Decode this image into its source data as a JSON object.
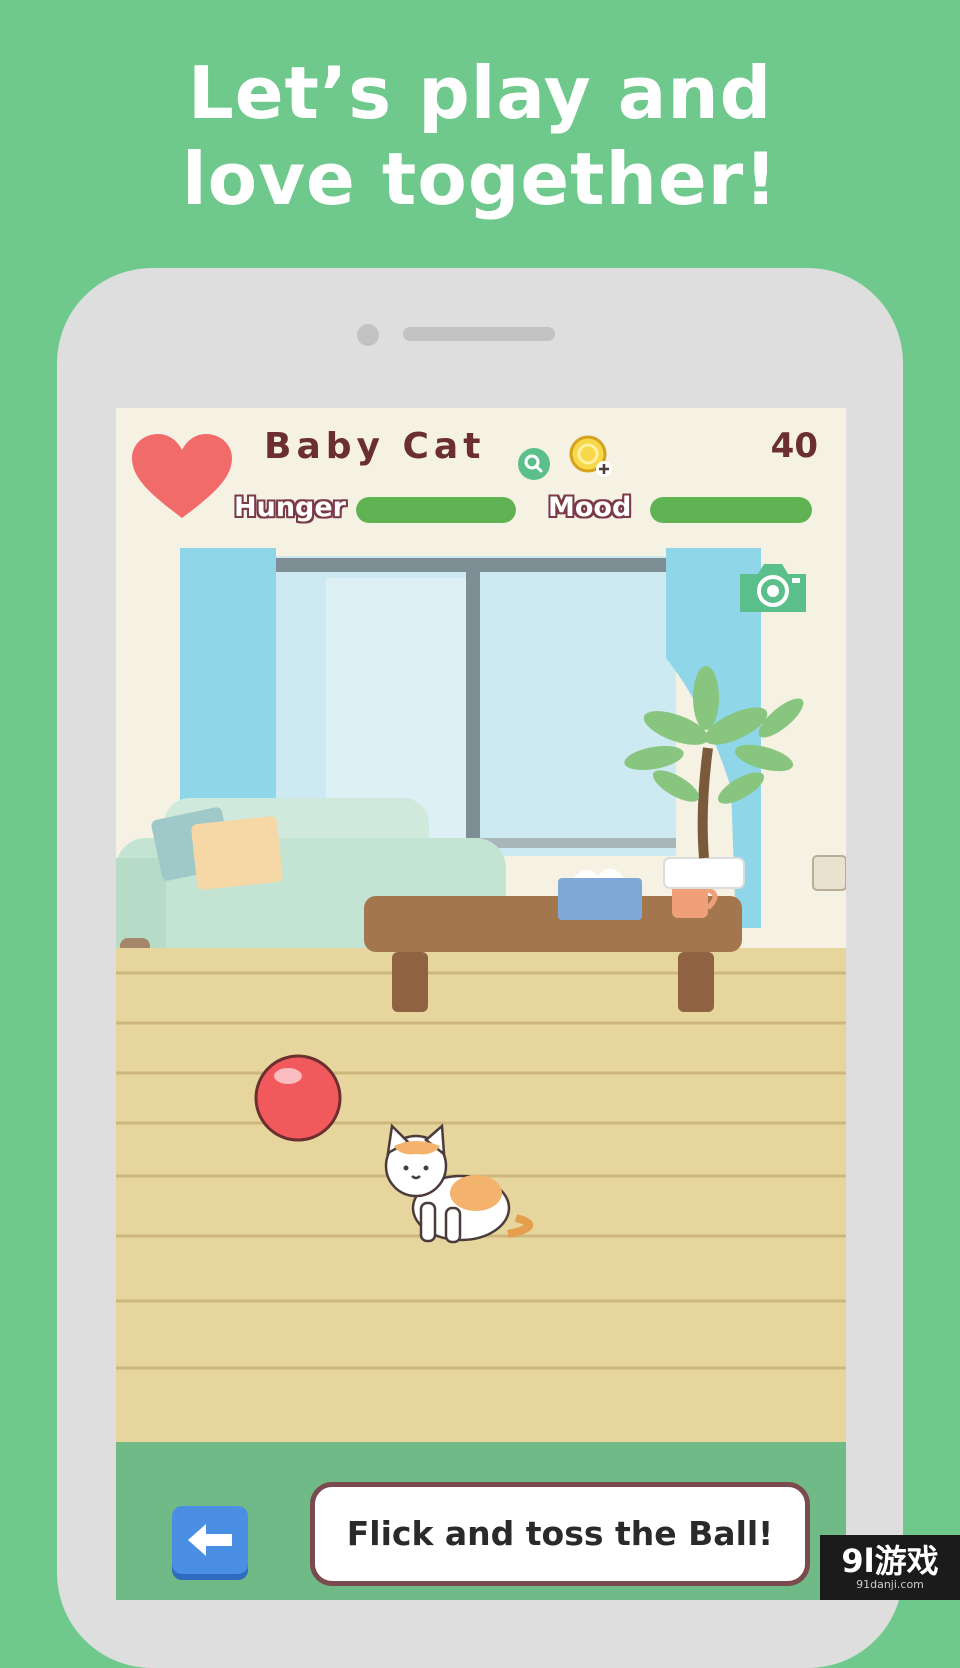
{
  "headline": {
    "line1": "Let’s play and",
    "line2": "love together!"
  },
  "hud": {
    "pet_name": "Baby Cat",
    "coins": "40",
    "hunger_label": "Hunger",
    "hunger_level": 1.0,
    "mood_label": "Mood",
    "mood_level": 1.0
  },
  "icons": {
    "heart": "heart-icon",
    "magnifier": "magnifier-icon",
    "coin": "coin-plus-icon",
    "camera": "camera-icon",
    "back": "left-arrow-icon"
  },
  "colors": {
    "background": "#6fc98c",
    "heart": "#f26b6b",
    "bar_fill": "#5fb352",
    "ball": "#f2595d",
    "back_button": "#4a8fe3"
  },
  "bottom": {
    "hint": "Flick and toss the Ball!"
  },
  "watermark": {
    "main": "9l游戏",
    "sub": "91danji.com"
  }
}
